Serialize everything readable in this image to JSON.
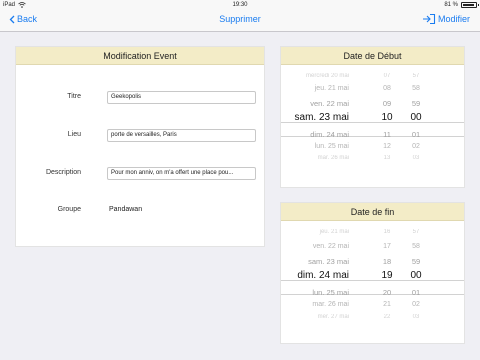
{
  "status": {
    "device": "iPad",
    "time": "19:30",
    "battery": "81 %"
  },
  "nav": {
    "back": "Back",
    "title": "Supprimer",
    "right": "Modifier"
  },
  "form": {
    "header": "Modification Event",
    "fields": [
      {
        "label": "Titre",
        "value": "Geekopolis"
      },
      {
        "label": "Lieu",
        "value": "porte de versailles, Paris"
      },
      {
        "label": "Description",
        "value": "Pour mon anniv, on m'a offert une place pou..."
      }
    ],
    "groupe": {
      "label": "Groupe",
      "value": "Pandawan"
    }
  },
  "start": {
    "header": "Date de Début",
    "rows": [
      {
        "date": "mercredi 20 mai",
        "hour": "07",
        "min": "57"
      },
      {
        "date": "jeu. 21 mai",
        "hour": "08",
        "min": "58"
      },
      {
        "date": "ven. 22 mai",
        "hour": "09",
        "min": "59"
      },
      {
        "date": "sam. 23 mai",
        "hour": "10",
        "min": "00"
      },
      {
        "date": "dim. 24 mai",
        "hour": "11",
        "min": "01"
      },
      {
        "date": "lun. 25 mai",
        "hour": "12",
        "min": "02"
      },
      {
        "date": "mar. 26 mai",
        "hour": "13",
        "min": "03"
      }
    ]
  },
  "end": {
    "header": "Date de fin",
    "rows": [
      {
        "date": "jeu. 21 mai",
        "hour": "16",
        "min": "57"
      },
      {
        "date": "ven. 22 mai",
        "hour": "17",
        "min": "58"
      },
      {
        "date": "sam. 23 mai",
        "hour": "18",
        "min": "59"
      },
      {
        "date": "dim. 24 mai",
        "hour": "19",
        "min": "00"
      },
      {
        "date": "lun. 25 mai",
        "hour": "20",
        "min": "01"
      },
      {
        "date": "mar. 26 mai",
        "hour": "21",
        "min": "02"
      },
      {
        "date": "mer. 27 mai",
        "hour": "22",
        "min": "03"
      }
    ]
  }
}
